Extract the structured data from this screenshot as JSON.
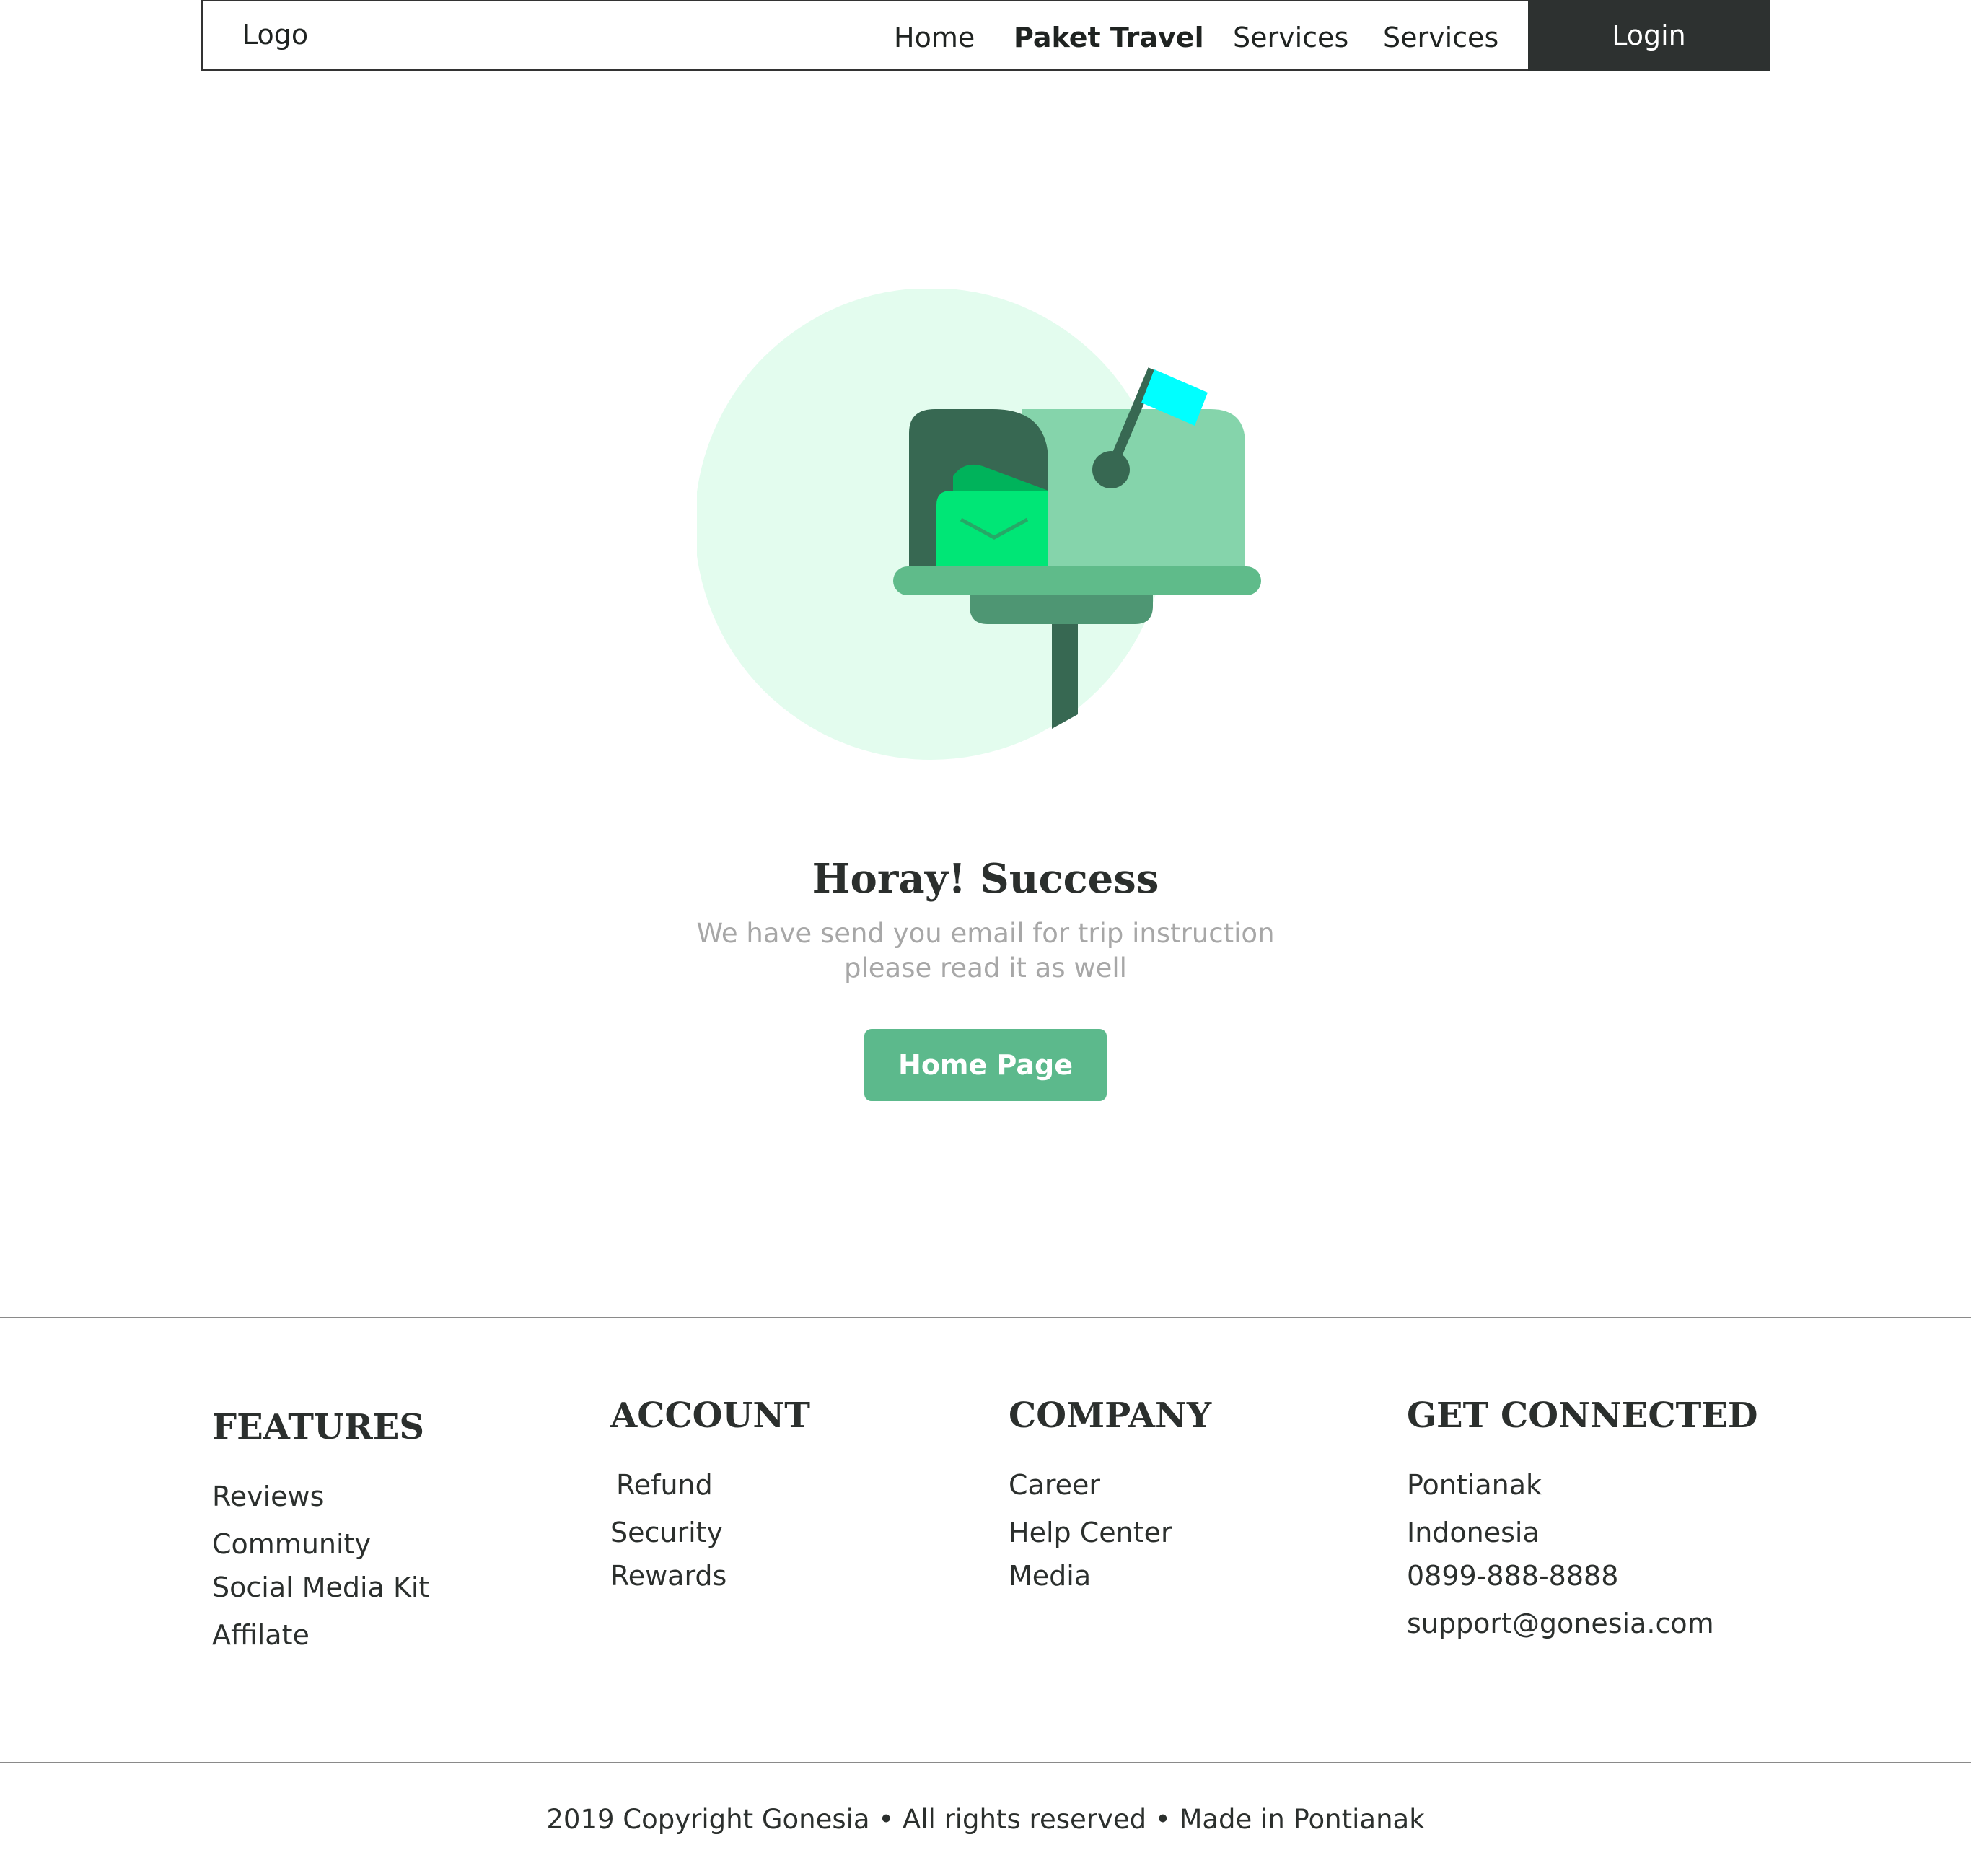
{
  "header": {
    "logo": "Logo",
    "nav": [
      "Home",
      "Paket Travel",
      "Services",
      "Services"
    ],
    "login_label": "Login"
  },
  "main": {
    "title": "Horay! Success",
    "subtitle_line1": "We have send you email for trip instruction",
    "subtitle_line2": "please read it as well",
    "button_label": "Home Page"
  },
  "illustration": {
    "icon": "mailbox-icon",
    "colors": {
      "circle": "#e3fcee",
      "box": "#85d4ab",
      "door": "#376852",
      "letter": "#00e676",
      "flag": "#00ffff",
      "shelf": "#5fbb8a",
      "base": "#4e9673"
    }
  },
  "footer": {
    "features": {
      "heading": "FEATURES",
      "items": [
        "Reviews",
        "Community",
        "Social Media Kit",
        "Affilate"
      ]
    },
    "account": {
      "heading": "ACCOUNT",
      "items": [
        "Refund",
        "Security",
        "Rewards"
      ]
    },
    "company": {
      "heading": "COMPANY",
      "items": [
        "Career",
        "Help Center",
        "Media"
      ]
    },
    "connected": {
      "heading": "GET CONNECTED",
      "items": [
        "Pontianak",
        "Indonesia",
        "0899-888-8888",
        "support@gonesia.com"
      ]
    },
    "copyright": "2019 Copyright Gonesia • All rights reserved • Made in Pontianak"
  }
}
